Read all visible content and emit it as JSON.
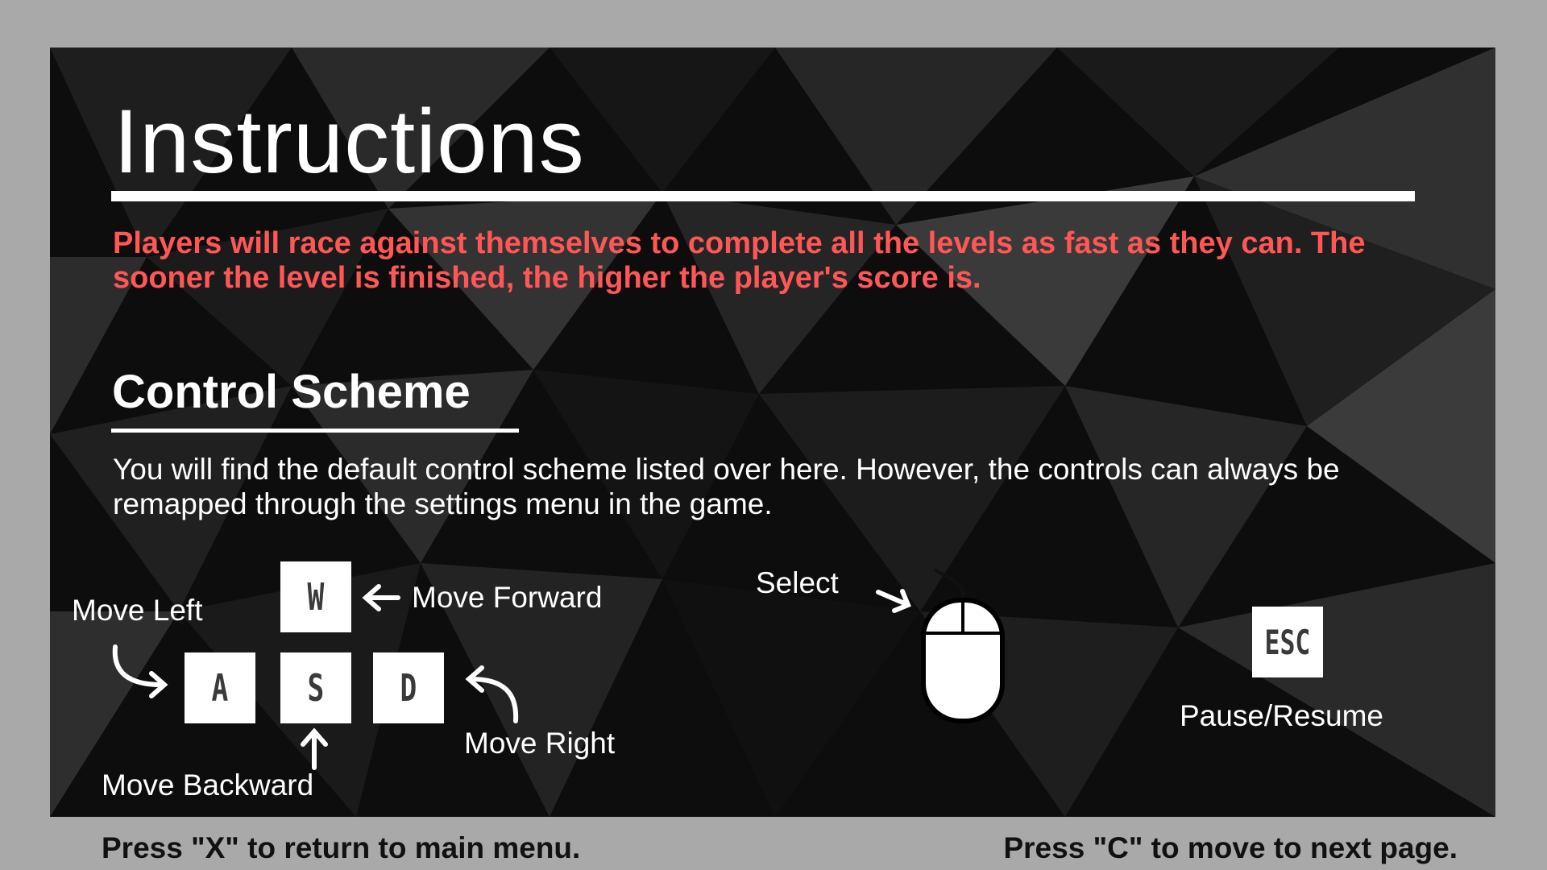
{
  "title": "Instructions",
  "intro": "Players will race against themselves to complete all the levels as fast as they can. The sooner the level is finished, the higher the player's score is.",
  "control_scheme": {
    "heading": "Control Scheme",
    "description": "You will find the default control scheme listed over here. However, the controls can always be remapped through the settings menu in the game.",
    "keys": {
      "w": "W",
      "a": "A",
      "s": "S",
      "d": "D",
      "esc": "ESC"
    },
    "labels": {
      "forward": "Move Forward",
      "left": "Move Left",
      "right": "Move Right",
      "backward": "Move Backward",
      "select": "Select",
      "pause": "Pause/Resume"
    }
  },
  "footer": {
    "back": "Press \"X\" to return to main menu.",
    "next": "Press \"C\" to move to next page."
  },
  "colors": {
    "accent": "#ff5757",
    "frame": "#a9a9a9",
    "panel": "#0d0d0d"
  }
}
